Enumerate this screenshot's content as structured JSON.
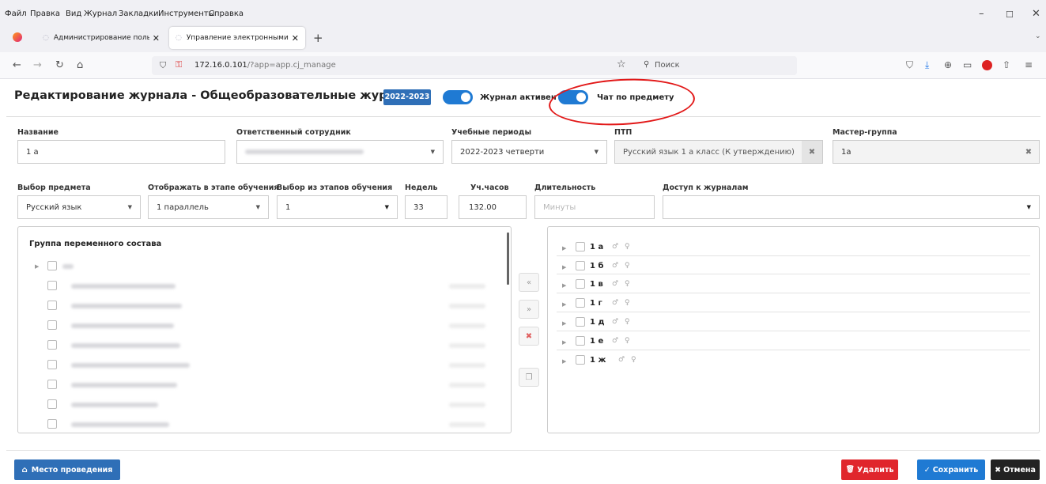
{
  "browser": {
    "menu": [
      "Файл",
      "Правка",
      "Вид",
      "Журнал",
      "Закладки",
      "Инструменты",
      "Справка"
    ],
    "tabs": [
      {
        "label": "Администрирование пользов"
      },
      {
        "label": "Управление электронными ж"
      }
    ],
    "url_host": "172.16.0.101",
    "url_path": "/?app=app.cj_manage",
    "search_placeholder": "Поиск"
  },
  "header": {
    "title": "Редактирование журнала - Общеобразовательные журналы",
    "year_badge": "2022-2023",
    "journal_active_label": "Журнал активен",
    "subject_chat_label": "Чат по предмету"
  },
  "form": {
    "name_label": "Название",
    "name_value": "1 а",
    "responsible_label": "Ответственный сотрудник",
    "periods_label": "Учебные периоды",
    "periods_value": "2022-2023 четверти",
    "ptp_label": "ПТП",
    "ptp_value": "Русский язык 1 а класс (К утверждению)",
    "master_group_label": "Мастер-группа",
    "master_group_value": "1а",
    "subject_label": "Выбор предмета",
    "subject_value": "Русский язык",
    "display_stage_label": "Отображать в этапе обучения",
    "display_stage_value": "1 параллель",
    "stages_label": "Выбор из этапов обучения",
    "stages_value": "1",
    "weeks_label": "Недель",
    "weeks_value": "33",
    "hours_label": "Уч.часов",
    "hours_value": "132.00",
    "duration_label": "Длительность",
    "duration_placeholder": "Минуты",
    "access_label": "Доступ к журналам"
  },
  "left_panel": {
    "title": "Группа переменного состава"
  },
  "groups": [
    "1 а",
    "1 б",
    "1 в",
    "1 г",
    "1 д",
    "1 е",
    "1 ж"
  ],
  "footer": {
    "location_button": "Место проведения",
    "delete_button": "Удалить",
    "save_button": "Сохранить",
    "cancel_button": "Отмена"
  },
  "colors": {
    "primary": "#2f6fb7",
    "toggle": "#1f7ad3",
    "danger": "#e0262c",
    "dark": "#222222",
    "annotation": "#e21818"
  }
}
